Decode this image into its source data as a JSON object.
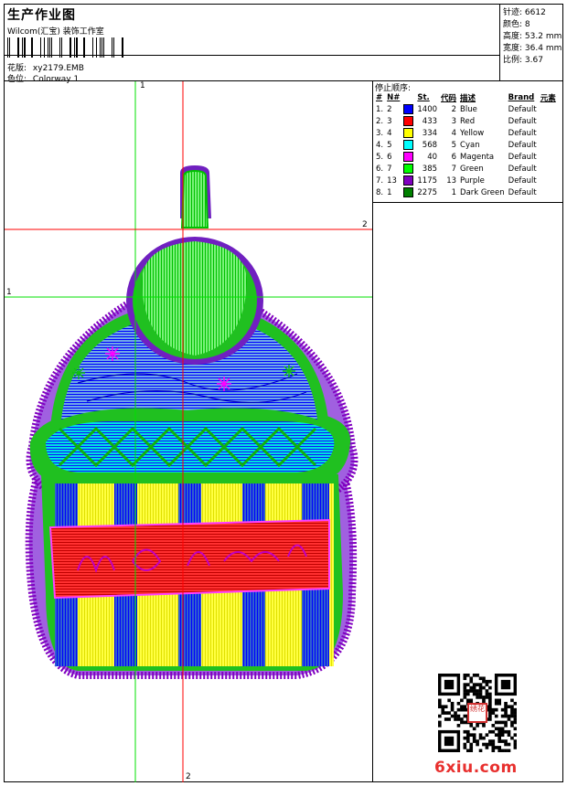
{
  "header": {
    "title": "生产作业图",
    "company": "Wilcom(汇宝) 装饰工作室",
    "design_label": "花版:",
    "design_value": "xy2179.EMB",
    "colorway_label": "色位:",
    "colorway_value": "Colorway 1"
  },
  "specs": [
    {
      "label": "针迹:",
      "value": "6612"
    },
    {
      "label": "颜色:",
      "value": "8"
    },
    {
      "label": "高度:",
      "value": "53.2 mm"
    },
    {
      "label": "宽度:",
      "value": "36.4 mm"
    },
    {
      "label": "比例:",
      "value": "3.67"
    }
  ],
  "stop_sequence": {
    "title": "停止顺序:",
    "columns": [
      "#",
      "N#",
      "St.",
      "代码",
      "描述",
      "Brand",
      "元素"
    ],
    "rows": [
      {
        "idx": "1.",
        "n": "2",
        "st": "1400",
        "code": "2",
        "desc": "Blue",
        "brand": "Default",
        "color": "#0000ff"
      },
      {
        "idx": "2.",
        "n": "3",
        "st": "433",
        "code": "3",
        "desc": "Red",
        "brand": "Default",
        "color": "#ff0000"
      },
      {
        "idx": "3.",
        "n": "4",
        "st": "334",
        "code": "4",
        "desc": "Yellow",
        "brand": "Default",
        "color": "#ffff00"
      },
      {
        "idx": "4.",
        "n": "5",
        "st": "568",
        "code": "5",
        "desc": "Cyan",
        "brand": "Default",
        "color": "#00ffff"
      },
      {
        "idx": "5.",
        "n": "6",
        "st": "40",
        "code": "6",
        "desc": "Magenta",
        "brand": "Default",
        "color": "#ff00ff"
      },
      {
        "idx": "6.",
        "n": "7",
        "st": "385",
        "code": "7",
        "desc": "Green",
        "brand": "Default",
        "color": "#00ff00"
      },
      {
        "idx": "7.",
        "n": "13",
        "st": "1175",
        "code": "13",
        "desc": "Purple",
        "brand": "Default",
        "color": "#8000c0"
      },
      {
        "idx": "8.",
        "n": "1",
        "st": "2275",
        "code": "1",
        "desc": "Dark Green",
        "brand": "Default",
        "color": "#008000"
      }
    ]
  },
  "guides": {
    "v1_label": "1",
    "v2_label": "2",
    "h1_label": "1",
    "h2_label": "2"
  },
  "watermark": "6xiu.com",
  "qr_stamp": "绣花"
}
